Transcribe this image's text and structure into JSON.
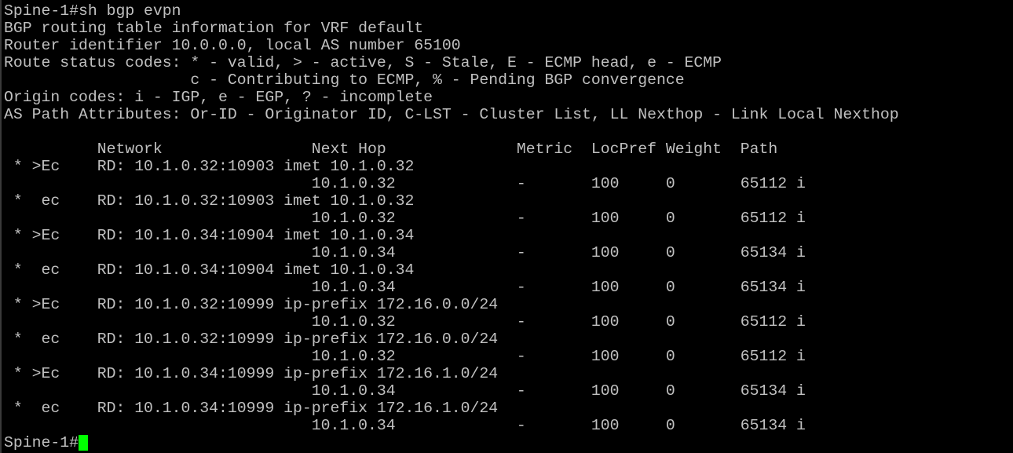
{
  "terminal": {
    "text_color": "#c0c0c0",
    "background_color": "#000000",
    "cursor_color": "#00ff00",
    "header_lines": [
      "Spine-1#sh bgp evpn",
      "BGP routing table information for VRF default",
      "Router identifier 10.0.0.0, local AS number 65100",
      "Route status codes: * - valid, > - active, S - Stale, E - ECMP head, e - ECMP",
      "                    c - Contributing to ECMP, % - Pending BGP convergence",
      "Origin codes: i - IGP, e - EGP, ? - incomplete",
      "AS Path Attributes: Or-ID - Originator ID, C-LST - Cluster List, LL Nexthop - Link Local Nexthop",
      ""
    ],
    "table_lines": [
      "          Network                Next Hop              Metric  LocPref Weight  Path",
      " * >Ec    RD: 10.1.0.32:10903 imet 10.1.0.32",
      "                                 10.1.0.32             -       100     0       65112 i",
      " *  ec    RD: 10.1.0.32:10903 imet 10.1.0.32",
      "                                 10.1.0.32             -       100     0       65112 i",
      " * >Ec    RD: 10.1.0.34:10904 imet 10.1.0.34",
      "                                 10.1.0.34             -       100     0       65134 i",
      " *  ec    RD: 10.1.0.34:10904 imet 10.1.0.34",
      "                                 10.1.0.34             -       100     0       65134 i",
      " * >Ec    RD: 10.1.0.32:10999 ip-prefix 172.16.0.0/24",
      "                                 10.1.0.32             -       100     0       65112 i",
      " *  ec    RD: 10.1.0.32:10999 ip-prefix 172.16.0.0/24",
      "                                 10.1.0.32             -       100     0       65112 i",
      " * >Ec    RD: 10.1.0.34:10999 ip-prefix 172.16.1.0/24",
      "                                 10.1.0.34             -       100     0       65134 i",
      " *  ec    RD: 10.1.0.34:10999 ip-prefix 172.16.1.0/24",
      "                                 10.1.0.34             -       100     0       65134 i"
    ],
    "prompt": "Spine-1#"
  }
}
